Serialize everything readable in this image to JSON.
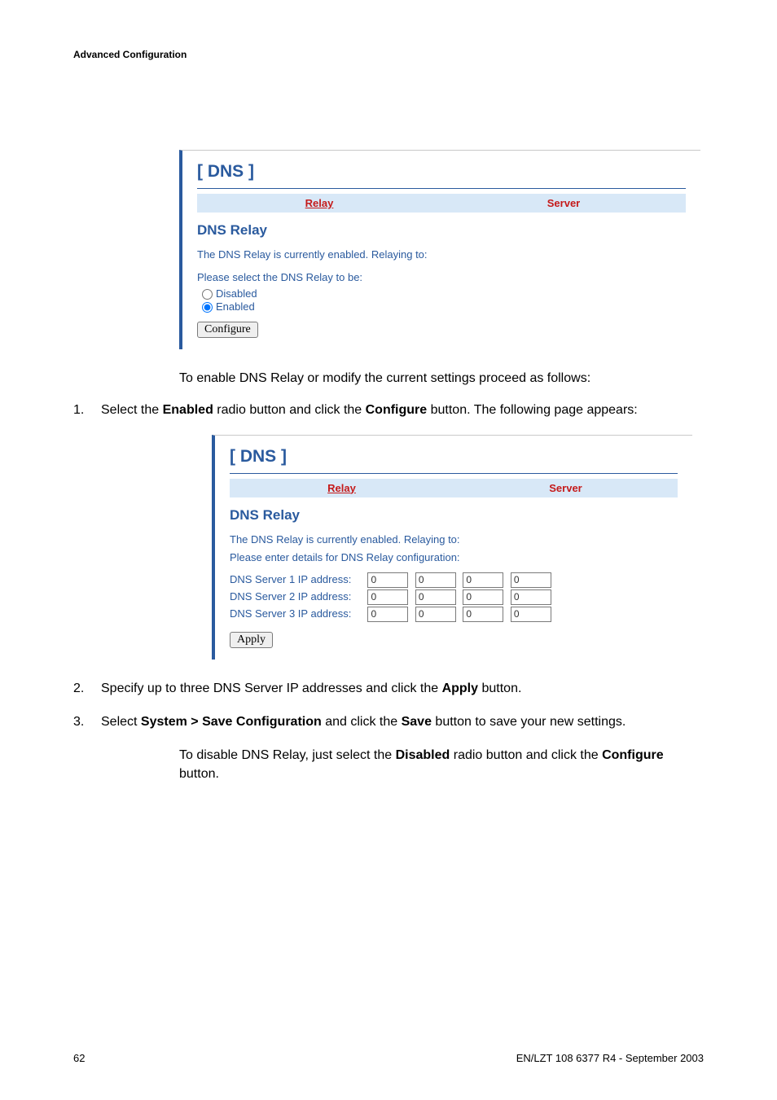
{
  "header": {
    "title": "Advanced Configuration"
  },
  "panel1": {
    "title": "[ DNS ]",
    "tab_relay": "Relay",
    "tab_server": "Server",
    "section": "DNS Relay",
    "status": "The DNS Relay is currently enabled. Relaying to:",
    "prompt": "Please select the DNS Relay to be:",
    "opt_disabled": "Disabled",
    "opt_enabled": "Enabled",
    "button": "Configure"
  },
  "text1": "To enable DNS Relay or modify the current settings proceed as follows:",
  "step1_pre": "Select the ",
  "step1_bold1": "Enabled",
  "step1_mid": " radio button and click the ",
  "step1_bold2": "Configure",
  "step1_post": " button. The following page appears:",
  "panel2": {
    "title": "[ DNS ]",
    "tab_relay": "Relay",
    "tab_server": "Server",
    "section": "DNS Relay",
    "status": "The DNS Relay is currently enabled. Relaying to:",
    "prompt": "Please enter details for DNS Relay configuration:",
    "rows": [
      {
        "label": "DNS Server 1 IP address:",
        "v": [
          "0",
          "0",
          "0",
          "0"
        ]
      },
      {
        "label": "DNS Server 2 IP address:",
        "v": [
          "0",
          "0",
          "0",
          "0"
        ]
      },
      {
        "label": "DNS Server 3 IP address:",
        "v": [
          "0",
          "0",
          "0",
          "0"
        ]
      }
    ],
    "button": "Apply"
  },
  "step2_pre": "Specify up to three DNS Server IP addresses and click the ",
  "step2_bold1": "Apply",
  "step2_post": " button.",
  "step3_pre": "Select ",
  "step3_bold1": "System > Save Configuration",
  "step3_mid": " and click the ",
  "step3_bold2": "Save",
  "step3_post": " button to save your new settings.",
  "text2_pre": "To disable DNS Relay, just select the ",
  "text2_bold1": "Disabled",
  "text2_mid": " radio button and click the ",
  "text2_bold2": "Configure",
  "text2_post": " button.",
  "footer": {
    "page": "62",
    "docid": "EN/LZT 108 6377 R4 - September 2003"
  }
}
